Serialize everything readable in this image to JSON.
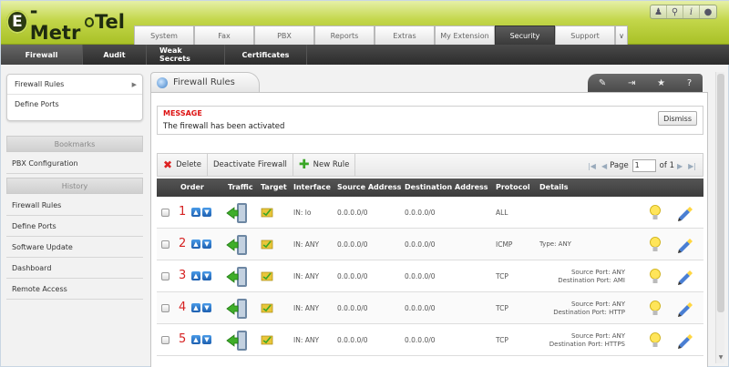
{
  "app": {
    "logo_text_1": "-Metr",
    "logo_letter": "E",
    "logo_text_2": "Tel",
    "brand_green": "#a9c127"
  },
  "top_icons": [
    "user-icon",
    "search-icon",
    "info-icon",
    "flame-icon"
  ],
  "main_tabs": [
    {
      "label": "System"
    },
    {
      "label": "Fax"
    },
    {
      "label": "PBX"
    },
    {
      "label": "Reports"
    },
    {
      "label": "Extras"
    },
    {
      "label": "My Extension"
    },
    {
      "label": "Security",
      "active": true
    },
    {
      "label": "Support"
    }
  ],
  "sub_tabs": [
    {
      "label": "Firewall",
      "active": true
    },
    {
      "label": "Audit"
    },
    {
      "label": "Weak Secrets"
    },
    {
      "label": "Certificates"
    }
  ],
  "sidebar": {
    "menu": [
      {
        "label": "Firewall Rules"
      },
      {
        "label": "Define Ports"
      }
    ],
    "bookmarks_title": "Bookmarks",
    "bookmarks": [
      {
        "label": "PBX Configuration"
      }
    ],
    "history_title": "History",
    "history": [
      {
        "label": "Firewall Rules"
      },
      {
        "label": "Define Ports"
      },
      {
        "label": "Software Update"
      },
      {
        "label": "Dashboard"
      },
      {
        "label": "Remote Access"
      }
    ]
  },
  "panel": {
    "title": "Firewall Rules",
    "tools": [
      "edit-icon",
      "pin-icon",
      "star-icon",
      "help-icon"
    ]
  },
  "message": {
    "title": "MESSAGE",
    "text": "The firewall has been activated",
    "dismiss_label": "Dismiss"
  },
  "toolbar": {
    "delete_label": "Delete",
    "deactivate_label": "Deactivate Firewall",
    "new_rule_label": "New Rule",
    "page_label": "Page",
    "page_value": "1",
    "of_label": "of 1"
  },
  "table": {
    "headers": {
      "order": "Order",
      "traffic": "Traffic",
      "target": "Target",
      "interface": "Interface",
      "source": "Source Address",
      "destination": "Destination Address",
      "protocol": "Protocol",
      "details": "Details"
    },
    "rows": [
      {
        "order": "1",
        "interface": "IN: lo",
        "source": "0.0.0.0/0",
        "destination": "0.0.0.0/0",
        "protocol": "ALL",
        "details_1": "",
        "details_2": "",
        "details_left": ""
      },
      {
        "order": "2",
        "interface": "IN: ANY",
        "source": "0.0.0.0/0",
        "destination": "0.0.0.0/0",
        "protocol": "ICMP",
        "details_1": "",
        "details_2": "",
        "details_left": "Type: ANY"
      },
      {
        "order": "3",
        "interface": "IN: ANY",
        "source": "0.0.0.0/0",
        "destination": "0.0.0.0/0",
        "protocol": "TCP",
        "details_1": "Source Port: ANY",
        "details_2": "Destination Port: AMI",
        "details_left": ""
      },
      {
        "order": "4",
        "interface": "IN: ANY",
        "source": "0.0.0.0/0",
        "destination": "0.0.0.0/0",
        "protocol": "TCP",
        "details_1": "Source Port: ANY",
        "details_2": "Destination Port: HTTP",
        "details_left": ""
      },
      {
        "order": "5",
        "interface": "IN: ANY",
        "source": "0.0.0.0/0",
        "destination": "0.0.0.0/0",
        "protocol": "TCP",
        "details_1": "Source Port: ANY",
        "details_2": "Destination Port: HTTPS",
        "details_left": ""
      }
    ]
  }
}
